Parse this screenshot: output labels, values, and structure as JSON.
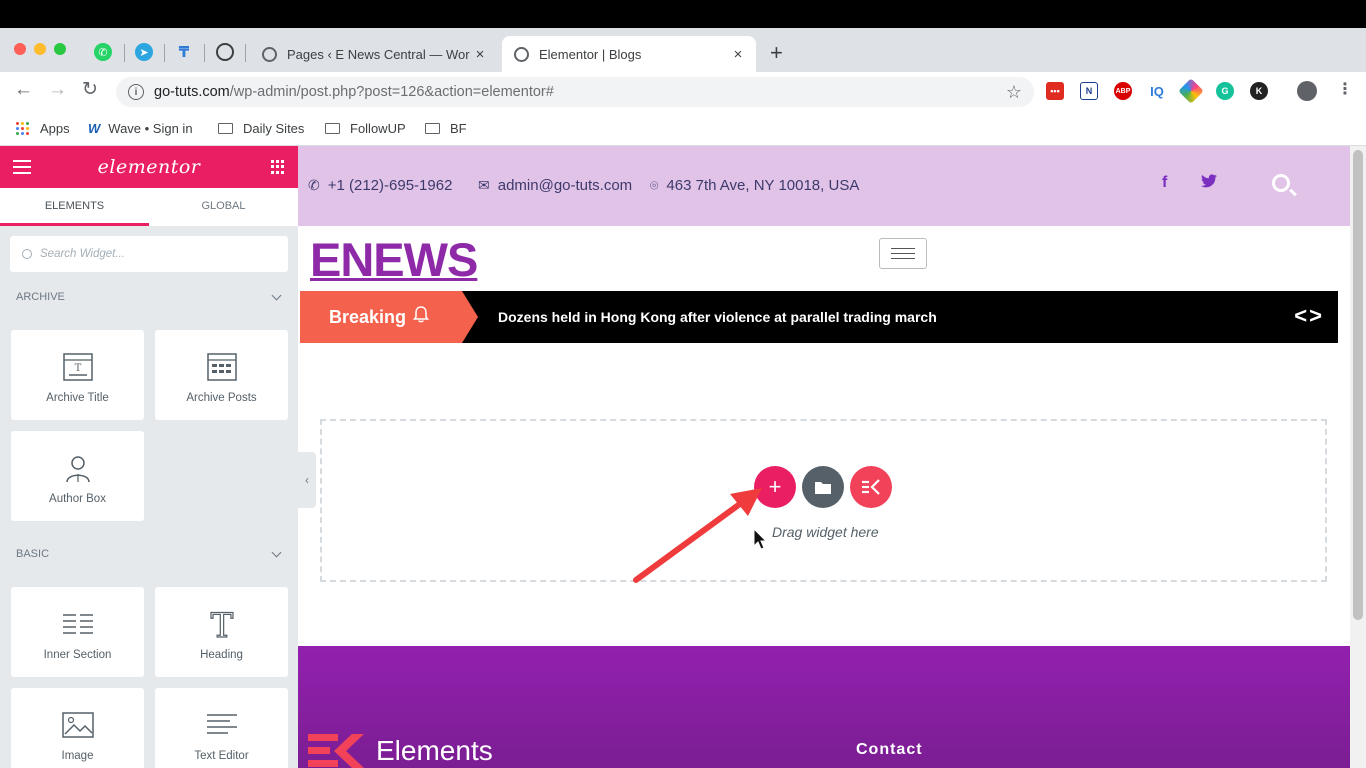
{
  "browser": {
    "tabs": [
      {
        "title": "Pages ‹ E News Central — WordPress"
      },
      {
        "title": "Elementor | Blogs"
      }
    ],
    "new_tab_symbol": "+",
    "close_symbol": "×",
    "url_host": "go-tuts.com",
    "url_path": "/wp-admin/post.php?post=126&action=elementor#",
    "bookmarks": [
      {
        "label": "Apps",
        "icon": "apps-grid-icon"
      },
      {
        "label": "Wave • Sign in",
        "icon": "wave-icon"
      },
      {
        "label": "Daily Sites",
        "icon": "folder-icon"
      },
      {
        "label": "FollowUP",
        "icon": "folder-icon"
      },
      {
        "label": "BF",
        "icon": "folder-icon"
      }
    ],
    "extensions": [
      {
        "label": "•••",
        "color": "#e02b20"
      },
      {
        "label": "N",
        "color": "#ffffff"
      },
      {
        "label": "ABP",
        "color": "#d90000"
      },
      {
        "label": "IQ",
        "color": "#2f7cd8"
      },
      {
        "label": "",
        "color": "#ff3d8b"
      },
      {
        "label": "G",
        "color": "#15c39a"
      },
      {
        "label": "K",
        "color": "#222222"
      }
    ]
  },
  "panel": {
    "brand": "elementor",
    "tabs": [
      "ELEMENTS",
      "GLOBAL"
    ],
    "search_placeholder": "Search Widget...",
    "categories": [
      {
        "title": "ARCHIVE",
        "widgets": [
          {
            "label": "Archive Title",
            "icon": "archive-title-icon"
          },
          {
            "label": "Archive Posts",
            "icon": "archive-posts-icon"
          },
          {
            "label": "Author Box",
            "icon": "author-box-icon"
          }
        ]
      },
      {
        "title": "BASIC",
        "widgets": [
          {
            "label": "Inner Section",
            "icon": "inner-section-icon"
          },
          {
            "label": "Heading",
            "icon": "heading-icon"
          },
          {
            "label": "Image",
            "icon": "image-icon"
          },
          {
            "label": "Text Editor",
            "icon": "text-editor-icon"
          }
        ]
      }
    ]
  },
  "site": {
    "phone": "+1 (212)-695-1962",
    "email": "admin@go-tuts.com",
    "address": "463 7th Ave, NY 10018, USA",
    "social": [
      "f",
      "twitter"
    ],
    "logo": "ENEWS",
    "breaking_label": "Breaking",
    "breaking_headline": "Dozens held in Hong Kong after violence at parallel trading march",
    "breaking_nav": "<>",
    "dropzone_text": "Drag widget here",
    "footer_brand": "Elements",
    "footer_contact": "Contact"
  },
  "colors": {
    "accent": "#e91e63",
    "info_bar": "#e1c3e8",
    "logo": "#8e2aa8",
    "breaking": "#f4614c",
    "footer": "#9220ae",
    "annotation_arrow": "#ef3b3b"
  }
}
